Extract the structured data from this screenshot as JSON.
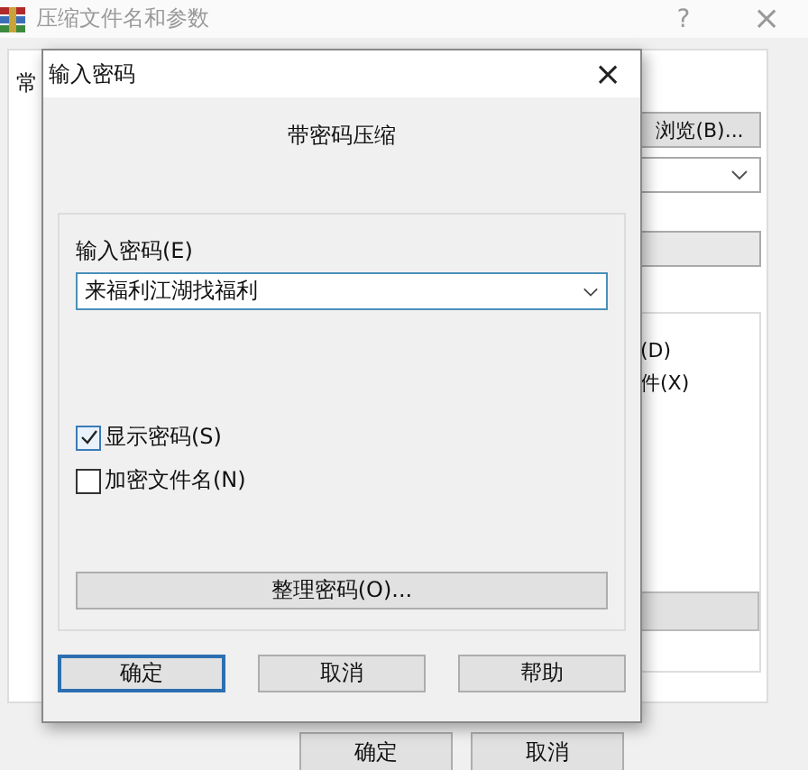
{
  "back_window": {
    "title": "压缩文件名和参数",
    "help_button": "?",
    "close_button": "×",
    "tab": "常",
    "browse_button": "浏览(B)...",
    "option_1": "(D)",
    "option_2": "件(X)",
    "buttons": [
      "确定",
      "取消"
    ]
  },
  "dialog": {
    "title": "输入密码",
    "close_button": "×",
    "heading": "带密码压缩",
    "password_label": "输入密码(E)",
    "password": {
      "value": "来福利江湖找福利"
    },
    "checkboxes": [
      {
        "label": "显示密码(S)",
        "checked": true
      },
      {
        "label": "加密文件名(N)",
        "checked": false
      }
    ],
    "organize_button": "整理密码(O)...",
    "buttons": [
      {
        "label": "确定",
        "default": true
      },
      {
        "label": "取消",
        "default": false
      },
      {
        "label": "帮助",
        "default": false
      }
    ]
  }
}
